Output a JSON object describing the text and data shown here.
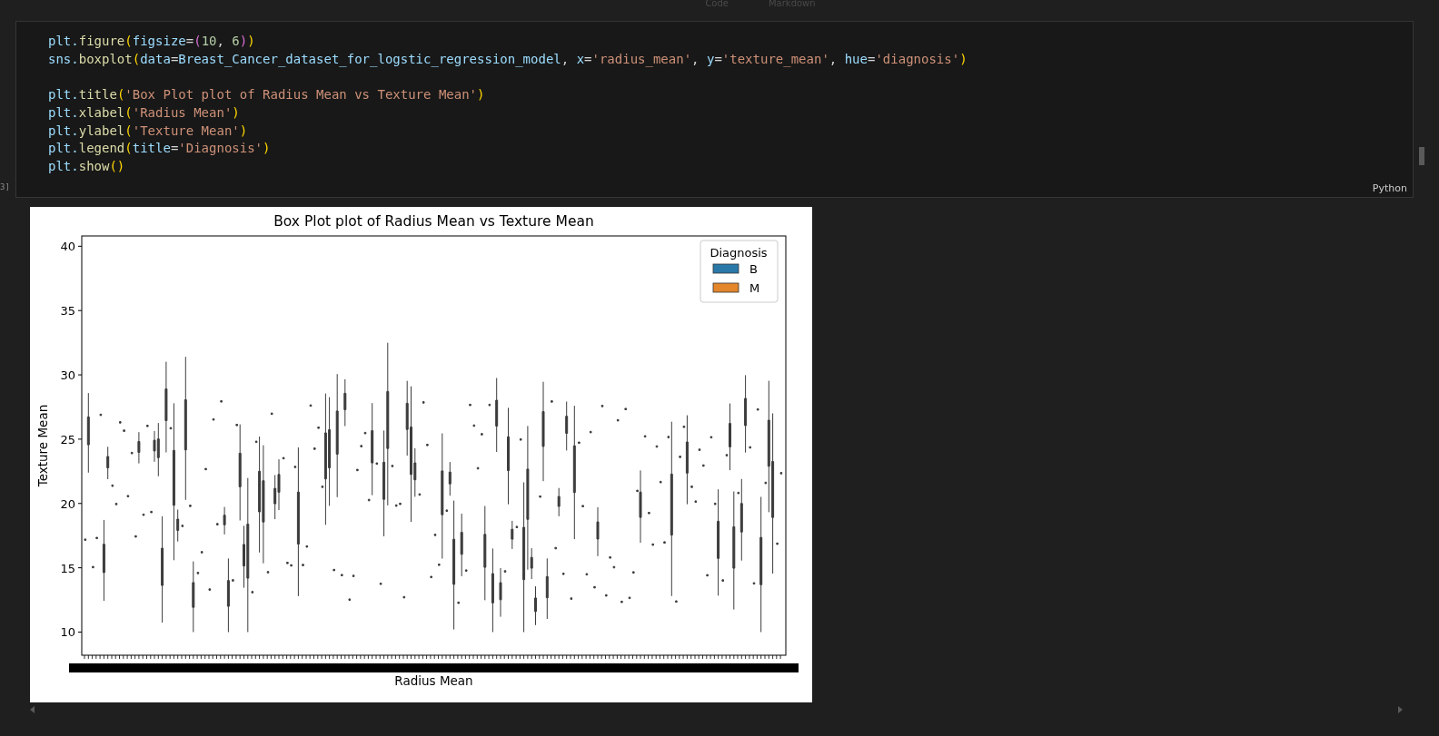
{
  "toolbar": [
    {
      "label": "Code"
    },
    {
      "label": "Markdown"
    }
  ],
  "cell": {
    "execution_count": "3]",
    "language": "Python",
    "code_blocks": [
      {
        "lines": [
          [
            {
              "kind": "var",
              "text": "plt."
            },
            {
              "kind": "fn",
              "text": "figure"
            },
            {
              "kind": "bracket",
              "text": "("
            },
            {
              "kind": "var",
              "text": "figsize"
            },
            {
              "kind": "punct",
              "text": "="
            },
            {
              "kind": "bracket2",
              "text": "("
            },
            {
              "kind": "num",
              "text": "10"
            },
            {
              "kind": "punct",
              "text": ", "
            },
            {
              "kind": "num",
              "text": "6"
            },
            {
              "kind": "bracket2",
              "text": ")"
            },
            {
              "kind": "bracket",
              "text": ")"
            }
          ],
          [
            {
              "kind": "var",
              "text": "sns."
            },
            {
              "kind": "fn",
              "text": "boxplot"
            },
            {
              "kind": "bracket",
              "text": "("
            },
            {
              "kind": "var",
              "text": "data"
            },
            {
              "kind": "punct",
              "text": "="
            },
            {
              "kind": "var",
              "text": "Breast_Cancer_dataset_for_logstic_regression_model"
            },
            {
              "kind": "punct",
              "text": ", "
            },
            {
              "kind": "var",
              "text": "x"
            },
            {
              "kind": "punct",
              "text": "="
            },
            {
              "kind": "str",
              "text": "'radius_mean'"
            },
            {
              "kind": "punct",
              "text": ", "
            },
            {
              "kind": "var",
              "text": "y"
            },
            {
              "kind": "punct",
              "text": "="
            },
            {
              "kind": "str",
              "text": "'texture_mean'"
            },
            {
              "kind": "punct",
              "text": ", "
            },
            {
              "kind": "var",
              "text": "hue"
            },
            {
              "kind": "punct",
              "text": "="
            },
            {
              "kind": "str",
              "text": "'diagnosis'"
            },
            {
              "kind": "bracket",
              "text": ")"
            }
          ]
        ]
      },
      {
        "lines": [
          [
            {
              "kind": "var",
              "text": "plt."
            },
            {
              "kind": "fn",
              "text": "title"
            },
            {
              "kind": "bracket",
              "text": "("
            },
            {
              "kind": "str",
              "text": "'Box Plot plot of Radius Mean vs Texture Mean'"
            },
            {
              "kind": "bracket",
              "text": ")"
            }
          ],
          [
            {
              "kind": "var",
              "text": "plt."
            },
            {
              "kind": "fn",
              "text": "xlabel"
            },
            {
              "kind": "bracket",
              "text": "("
            },
            {
              "kind": "str",
              "text": "'Radius Mean'"
            },
            {
              "kind": "bracket",
              "text": ")"
            }
          ],
          [
            {
              "kind": "var",
              "text": "plt."
            },
            {
              "kind": "fn",
              "text": "ylabel"
            },
            {
              "kind": "bracket",
              "text": "("
            },
            {
              "kind": "str",
              "text": "'Texture Mean'"
            },
            {
              "kind": "bracket",
              "text": ")"
            }
          ],
          [
            {
              "kind": "var",
              "text": "plt."
            },
            {
              "kind": "fn",
              "text": "legend"
            },
            {
              "kind": "bracket",
              "text": "("
            },
            {
              "kind": "var",
              "text": "title"
            },
            {
              "kind": "punct",
              "text": "="
            },
            {
              "kind": "str",
              "text": "'Diagnosis'"
            },
            {
              "kind": "bracket",
              "text": ")"
            }
          ],
          [
            {
              "kind": "var",
              "text": "plt."
            },
            {
              "kind": "fn",
              "text": "show"
            },
            {
              "kind": "bracket",
              "text": "()"
            }
          ]
        ]
      }
    ]
  },
  "output": {
    "figure": {
      "title": "Box Plot plot of Radius Mean vs Texture Mean",
      "xlabel": "Radius Mean",
      "ylabel": "Texture Mean",
      "yticks": [
        "40",
        "35",
        "30",
        "25",
        "20",
        "15",
        "10"
      ],
      "legend": {
        "title": "Diagnosis",
        "entries": [
          {
            "label": "B",
            "color": "#2a78a8"
          },
          {
            "label": "M",
            "color": "#e3862c"
          }
        ]
      }
    }
  }
}
